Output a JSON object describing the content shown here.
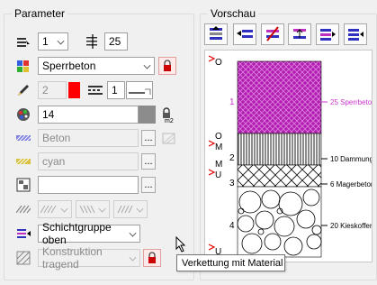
{
  "parameter": {
    "title": "Parameter",
    "row1": {
      "left_value": "1",
      "right_value": "25"
    },
    "material": {
      "value": "Sperrbeton"
    },
    "pen": {
      "value": "2",
      "color": "#ff0000",
      "line_value": "1"
    },
    "layer": {
      "value": "14"
    },
    "hatch": {
      "value": "Beton"
    },
    "color": {
      "value": "cyan"
    },
    "pattern": {
      "value": ""
    },
    "layer_group": {
      "value": "Schichtgruppe oben"
    },
    "construction": {
      "value": "Konstruktion tragend"
    }
  },
  "preview": {
    "title": "Vorschau",
    "layers": [
      {
        "label": "25 Sperrbeton",
        "index": "1",
        "color": "#cc33cc"
      },
      {
        "label": "10 Dammung",
        "index": "2"
      },
      {
        "label": "6 Magerbeton",
        "index": "3"
      },
      {
        "label": "20 Kieskoffer",
        "index": "4"
      }
    ],
    "markers": {
      "top": "O",
      "m1": "M",
      "m2": "M",
      "u1": "U",
      "bottom": "U"
    }
  },
  "tooltip": {
    "text": "Verkettung mit Material"
  },
  "colors": {
    "accent": "#cc0000",
    "magenta": "#aa00aa",
    "border": "#a0a0a0"
  }
}
